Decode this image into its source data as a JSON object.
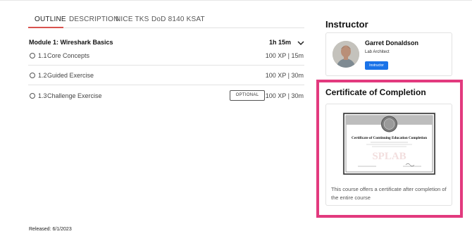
{
  "tabs": [
    {
      "label": "OUTLINE",
      "active": true
    },
    {
      "label": "DESCRIPTION",
      "active": false
    },
    {
      "label": "NICE TKS",
      "active": false
    },
    {
      "label": "DoD 8140 KSAT",
      "active": false
    }
  ],
  "module": {
    "title": "Module 1: Wireshark Basics",
    "duration": "1h 15m",
    "lessons": [
      {
        "number": "1.1",
        "title": "Core Concepts",
        "meta": "100 XP | 15m",
        "optional": false
      },
      {
        "number": "1.2",
        "title": "Guided Exercise",
        "meta": "100 XP | 30m",
        "optional": false
      },
      {
        "number": "1.3",
        "title": "Challenge Exercise",
        "meta": "100 XP | 30m",
        "optional": true,
        "optional_label": "OPTIONAL"
      }
    ]
  },
  "released": "Released: 6/1/2023",
  "instructor": {
    "heading": "Instructor",
    "name": "Garret Donaldson",
    "role": "Lab Architect",
    "badge": "Instructor"
  },
  "certificate": {
    "heading": "Certificate of Completion",
    "image_title": "Certificate of Continuing Education Completion",
    "watermark": "SPLAB",
    "description": "This course offers a certificate after completion of the entire course"
  },
  "colors": {
    "tab_underline": "#d9534f",
    "highlight_border": "#e23a7e",
    "badge": "#1a73e8"
  },
  "icons": {
    "chevron": "chevron-down-icon",
    "lesson_status": "circle-outline-icon"
  }
}
